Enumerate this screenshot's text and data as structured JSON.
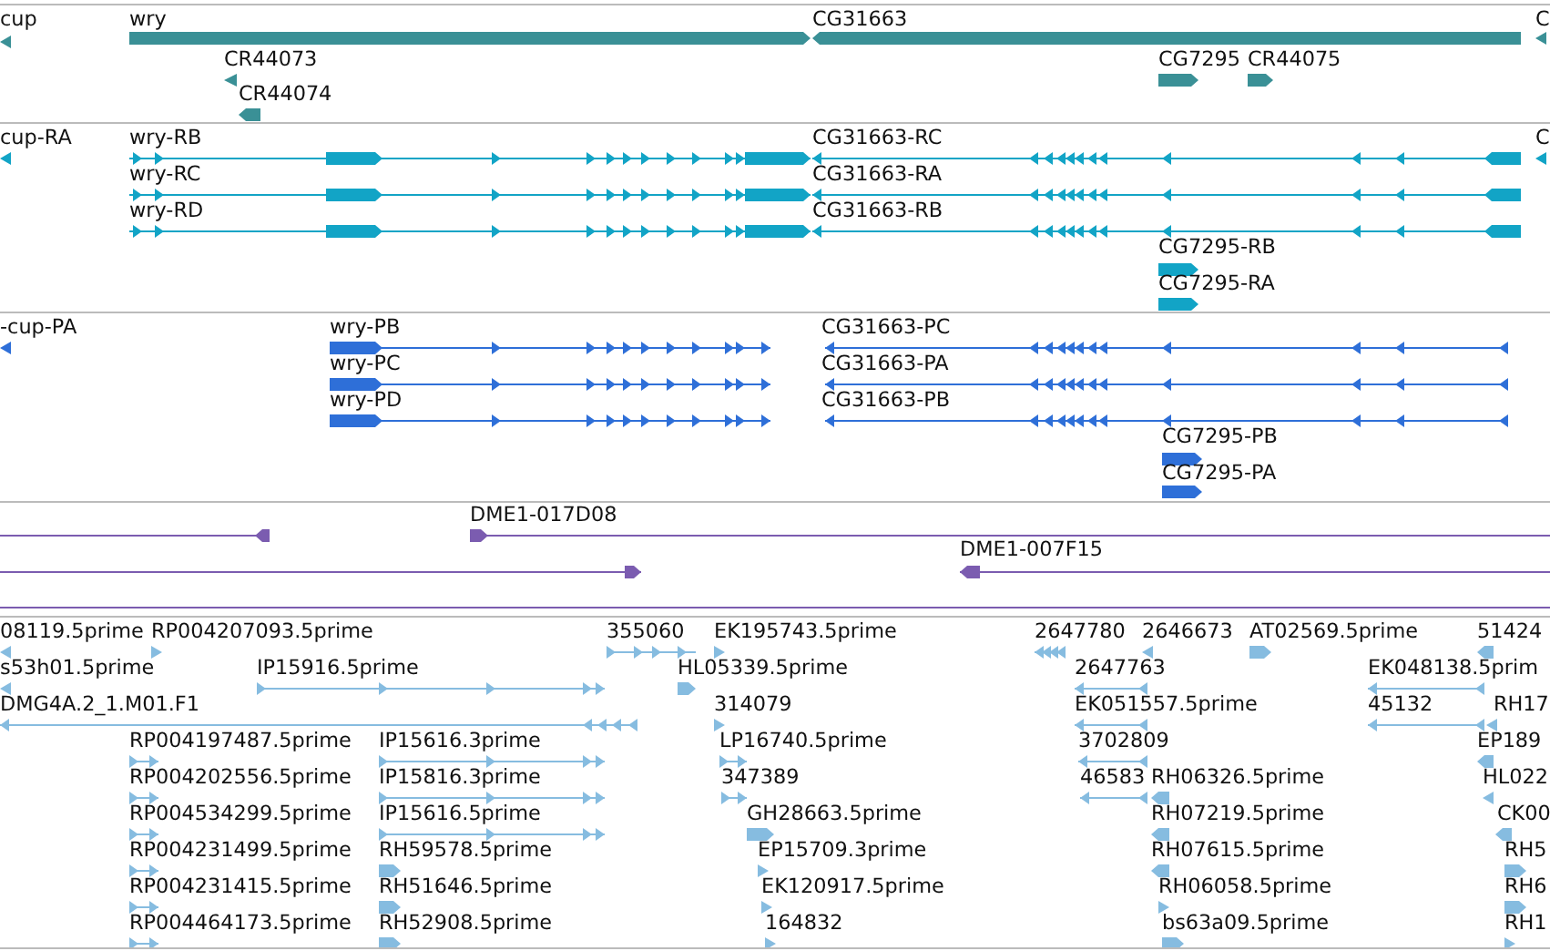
{
  "tracks": [
    {
      "color": "#3a9096",
      "features": [
        {
          "label": "cup",
          "reverse": true
        },
        {
          "label": "wry",
          "reverse": false
        },
        {
          "label": "CG31663",
          "reverse": true
        },
        {
          "label": "C",
          "reverse": true
        },
        {
          "label": "CR44073",
          "reverse": true
        },
        {
          "label": "CR44074",
          "reverse": true
        },
        {
          "label": "CG7295",
          "reverse": false
        },
        {
          "label": "CR44075",
          "reverse": false
        }
      ]
    },
    {
      "color": "#12a4c6",
      "features": [
        {
          "label": "cup-RA",
          "reverse": true
        },
        {
          "label": "wry-RB",
          "reverse": false
        },
        {
          "label": "CG31663-RC",
          "reverse": true
        },
        {
          "label": "C",
          "reverse": true
        },
        {
          "label": "wry-RC",
          "reverse": false
        },
        {
          "label": "CG31663-RA",
          "reverse": true
        },
        {
          "label": "wry-RD",
          "reverse": false
        },
        {
          "label": "CG31663-RB",
          "reverse": true
        },
        {
          "label": "CG7295-RB",
          "reverse": false
        },
        {
          "label": "CG7295-RA",
          "reverse": false
        }
      ]
    },
    {
      "color": "#2e6fd8",
      "features": [
        {
          "label": "-cup-PA",
          "reverse": true
        },
        {
          "label": "wry-PB",
          "reverse": false
        },
        {
          "label": "CG31663-PC",
          "reverse": true
        },
        {
          "label": "wry-PC",
          "reverse": false
        },
        {
          "label": "CG31663-PA",
          "reverse": true
        },
        {
          "label": "wry-PD",
          "reverse": false
        },
        {
          "label": "CG31663-PB",
          "reverse": true
        },
        {
          "label": "CG7295-PB",
          "reverse": false
        },
        {
          "label": "CG7295-PA",
          "reverse": false
        }
      ]
    },
    {
      "color": "#7b5cb0",
      "features": [
        {
          "reverse": true
        },
        {
          "label": "DME1-017D08",
          "reverse": false
        },
        {
          "reverse": false
        },
        {
          "label": "DME1-007F15",
          "reverse": true
        }
      ]
    },
    {
      "color": "#86bce0",
      "features": [
        {
          "label": "08119.5prime",
          "reverse": true
        },
        {
          "label": "RP004207093.5prime",
          "reverse": false
        },
        {
          "label": "355060",
          "reverse": false
        },
        {
          "label": "EK195743.5prime",
          "reverse": false
        },
        {
          "label": "2647780",
          "reverse": true
        },
        {
          "label": "2646673",
          "reverse": true
        },
        {
          "label": "AT02569.5prime",
          "reverse": false
        },
        {
          "label": "51424",
          "reverse": true
        },
        {
          "label": "s53h01.5prime",
          "reverse": true
        },
        {
          "label": "IP15916.5prime",
          "reverse": false
        },
        {
          "label": "HL05339.5prime",
          "reverse": false
        },
        {
          "label": "2647763",
          "reverse": true
        },
        {
          "label": "EK048138.5prim",
          "reverse": true
        },
        {
          "label": "DMG4A.2_1.M01.F1",
          "reverse": true
        },
        {
          "label": "314079",
          "reverse": false
        },
        {
          "label": "EK051557.5prime",
          "reverse": true
        },
        {
          "label": "45132",
          "reverse": true
        },
        {
          "label": "RH17",
          "reverse": true
        },
        {
          "label": "RP004197487.5prime",
          "reverse": false
        },
        {
          "label": "IP15616.3prime",
          "reverse": false
        },
        {
          "label": "LP16740.5prime",
          "reverse": false
        },
        {
          "label": "3702809",
          "reverse": true
        },
        {
          "label": "EP189",
          "reverse": true
        },
        {
          "label": "RP004202556.5prime",
          "reverse": false
        },
        {
          "label": "IP15816.3prime",
          "reverse": false
        },
        {
          "label": "347389",
          "reverse": false
        },
        {
          "label": "46583",
          "reverse": true
        },
        {
          "label": "RH06326.5prime",
          "reverse": true
        },
        {
          "label": "HL022",
          "reverse": true
        },
        {
          "label": "RP004534299.5prime",
          "reverse": false
        },
        {
          "label": "IP15616.5prime",
          "reverse": false
        },
        {
          "label": "GH28663.5prime",
          "reverse": false
        },
        {
          "label": "RH07219.5prime",
          "reverse": true
        },
        {
          "label": "CK00",
          "reverse": true
        },
        {
          "label": "RP004231499.5prime",
          "reverse": false
        },
        {
          "label": "RH59578.5prime",
          "reverse": false
        },
        {
          "label": "EP15709.3prime",
          "reverse": false
        },
        {
          "label": "RH07615.5prime",
          "reverse": true
        },
        {
          "label": "RH5",
          "reverse": false
        },
        {
          "label": "RP004231415.5prime",
          "reverse": false
        },
        {
          "label": "RH51646.5prime",
          "reverse": false
        },
        {
          "label": "EK120917.5prime",
          "reverse": false
        },
        {
          "label": "RH06058.5prime",
          "reverse": false
        },
        {
          "label": "RH6",
          "reverse": false
        },
        {
          "label": "RP004464173.5prime",
          "reverse": false
        },
        {
          "label": "RH52908.5prime",
          "reverse": false
        },
        {
          "label": "164832",
          "reverse": false
        },
        {
          "label": "bs63a09.5prime",
          "reverse": false
        },
        {
          "label": "RH1",
          "reverse": false
        }
      ]
    }
  ]
}
